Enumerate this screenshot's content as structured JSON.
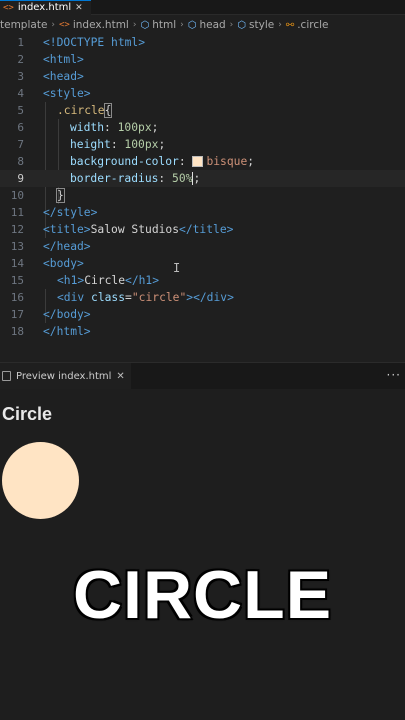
{
  "tabs": {
    "active_label": "index.html"
  },
  "breadcrumb": {
    "items": [
      "template",
      "index.html",
      "html",
      "head",
      "style",
      ".circle"
    ]
  },
  "editor": {
    "line_numbers": [
      "1",
      "2",
      "3",
      "4",
      "5",
      "6",
      "7",
      "8",
      "9",
      "10",
      "11",
      "12",
      "13",
      "14",
      "15",
      "16",
      "17",
      "18"
    ],
    "current_line": "9",
    "code": {
      "l1_doctype": "<!DOCTYPE html>",
      "l2": "<html>",
      "l3": "<head>",
      "l4": "<style>",
      "l5_selector": ".circle",
      "l5_brace": "{",
      "l6_prop": "width",
      "l6_val": "100px",
      "l7_prop": "height",
      "l7_val": "100px",
      "l8_prop": "background-color",
      "l8_val": "bisque",
      "l9_prop": "border-radius",
      "l9_val": "50%",
      "l10_brace": "}",
      "l11": "</style>",
      "l12_open": "<title>",
      "l12_text": "Salow Studios",
      "l12_close": "</title>",
      "l13": "</head>",
      "l14": "<body>",
      "l15_open": "<h1>",
      "l15_text": "Circle",
      "l15_close": "</h1>",
      "l16_open": "<div",
      "l16_attr": "class",
      "l16_str": "\"circle\"",
      "l16_close": "></div>",
      "l17": "</body>",
      "l18": "</html>"
    }
  },
  "preview": {
    "tab_label": "Preview index.html",
    "heading": "Circle",
    "circle_color": "#ffe4c4"
  },
  "overlay": {
    "caption": "CIRCLE"
  },
  "colors": {
    "editor_bg": "#1f1f1f",
    "tag": "#569cd6",
    "attribute": "#9cdcfe",
    "string": "#ce9178",
    "selector": "#d7ba7d",
    "number": "#b5cea8"
  }
}
